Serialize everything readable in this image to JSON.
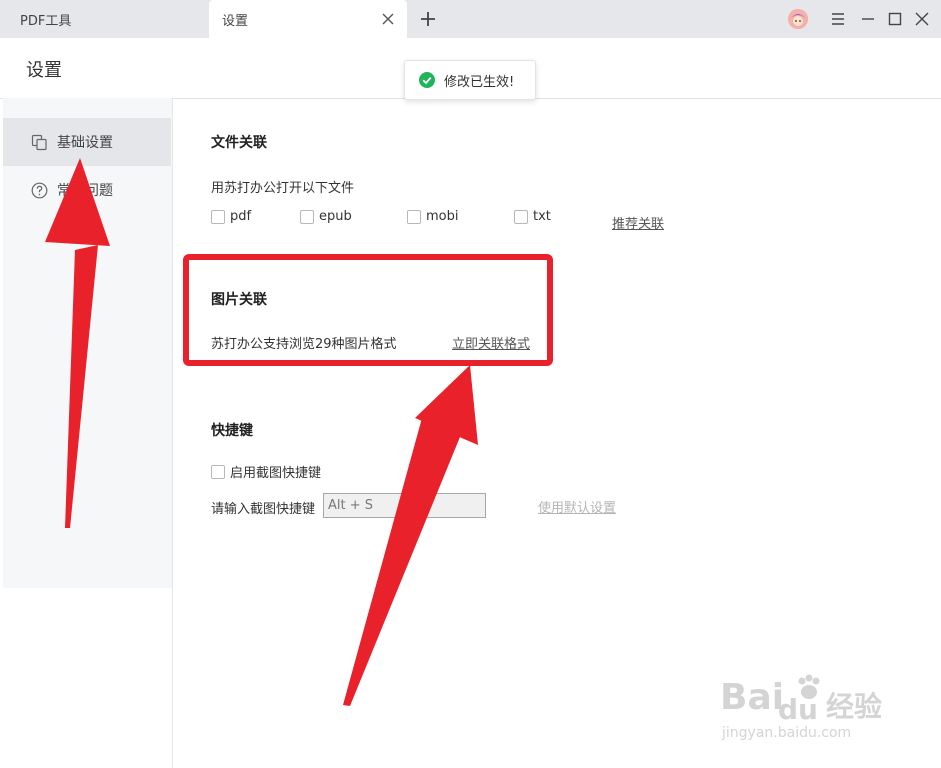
{
  "tabs": [
    {
      "label": "PDF工具"
    },
    {
      "label": "设置"
    }
  ],
  "header": {
    "title": "设置"
  },
  "toast": {
    "message": "修改已生效!"
  },
  "sidebar": {
    "items": [
      {
        "label": "基础设置",
        "icon": "copy-icon",
        "active": true
      },
      {
        "label": "常见问题",
        "icon": "help-circle-icon",
        "active": false
      }
    ]
  },
  "file_assoc": {
    "title": "文件关联",
    "description": "用苏打办公打开以下文件",
    "options": [
      "pdf",
      "epub",
      "mobi",
      "txt"
    ],
    "recommend_link": "推荐关联"
  },
  "image_assoc": {
    "title": "图片关联",
    "description": "苏打办公支持浏览29种图片格式",
    "link": "立即关联格式"
  },
  "shortcut": {
    "title": "快捷键",
    "enable_label": "启用截图快捷键",
    "input_label": "请输入截图快捷键",
    "input_value": "Alt + S",
    "default_link": "使用默认设置"
  },
  "watermark": {
    "brand": "Bai",
    "brand2": "du",
    "cn": "经验",
    "url": "jingyan.baidu.com"
  },
  "colors": {
    "accent_red": "#e8212b",
    "toast_green": "#1fb35a"
  }
}
